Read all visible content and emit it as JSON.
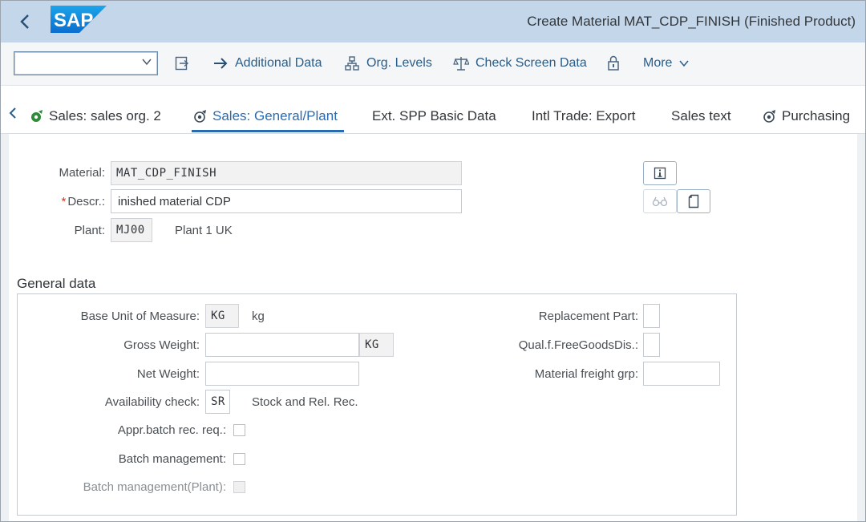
{
  "shell": {
    "back_label": "‹",
    "title": "Create Material MAT_CDP_FINISH (Finished Product)",
    "logo_text": "SAP"
  },
  "toolbar": {
    "command_value": "",
    "additional_data": "Additional Data",
    "org_levels": "Org. Levels",
    "check_screen_data": "Check Screen Data",
    "more": "More"
  },
  "tabs": [
    {
      "label": "Sales: sales org. 2",
      "icon": "sales-org-icon"
    },
    {
      "label": "Sales: General/Plant",
      "icon": "sales-plant-icon",
      "active": true
    },
    {
      "label": "Ext. SPP Basic Data"
    },
    {
      "label": "Intl Trade: Export"
    },
    {
      "label": "Sales text"
    },
    {
      "label": "Purchasing",
      "icon": "purchasing-icon"
    }
  ],
  "header_fields": {
    "material_label": "Material:",
    "material_value": "MAT_CDP_FINISH",
    "descr_label": "Descr.:",
    "descr_required": "*",
    "descr_value": "inished material CDP",
    "plant_label": "Plant:",
    "plant_value": "MJ00",
    "plant_text": "Plant 1 UK"
  },
  "general_data": {
    "title": "General data",
    "base_uom_label": "Base Unit of Measure:",
    "base_uom_value": "KG",
    "base_uom_text": "kg",
    "gross_weight_label": "Gross Weight:",
    "gross_weight_value": "",
    "gross_weight_unit": "KG",
    "net_weight_label": "Net Weight:",
    "net_weight_value": "",
    "availability_label": "Availability check:",
    "availability_value": "SR",
    "availability_text": "Stock and Rel. Rec.",
    "appr_batch_label": "Appr.batch rec. req.:",
    "batch_mgmt_label": "Batch management:",
    "batch_mgmt_plant_label": "Batch management(Plant):",
    "replacement_part_label": "Replacement Part:",
    "replacement_part_value": "",
    "qual_free_goods_label": "Qual.f.FreeGoodsDis.:",
    "qual_free_goods_value": "",
    "material_freight_label": "Material freight grp:",
    "material_freight_value": ""
  },
  "colors": {
    "shell_bg": "#c3d6ea",
    "accent": "#2a6bb0",
    "required": "#c0392b",
    "sap_blue": "#1a8fd8"
  }
}
